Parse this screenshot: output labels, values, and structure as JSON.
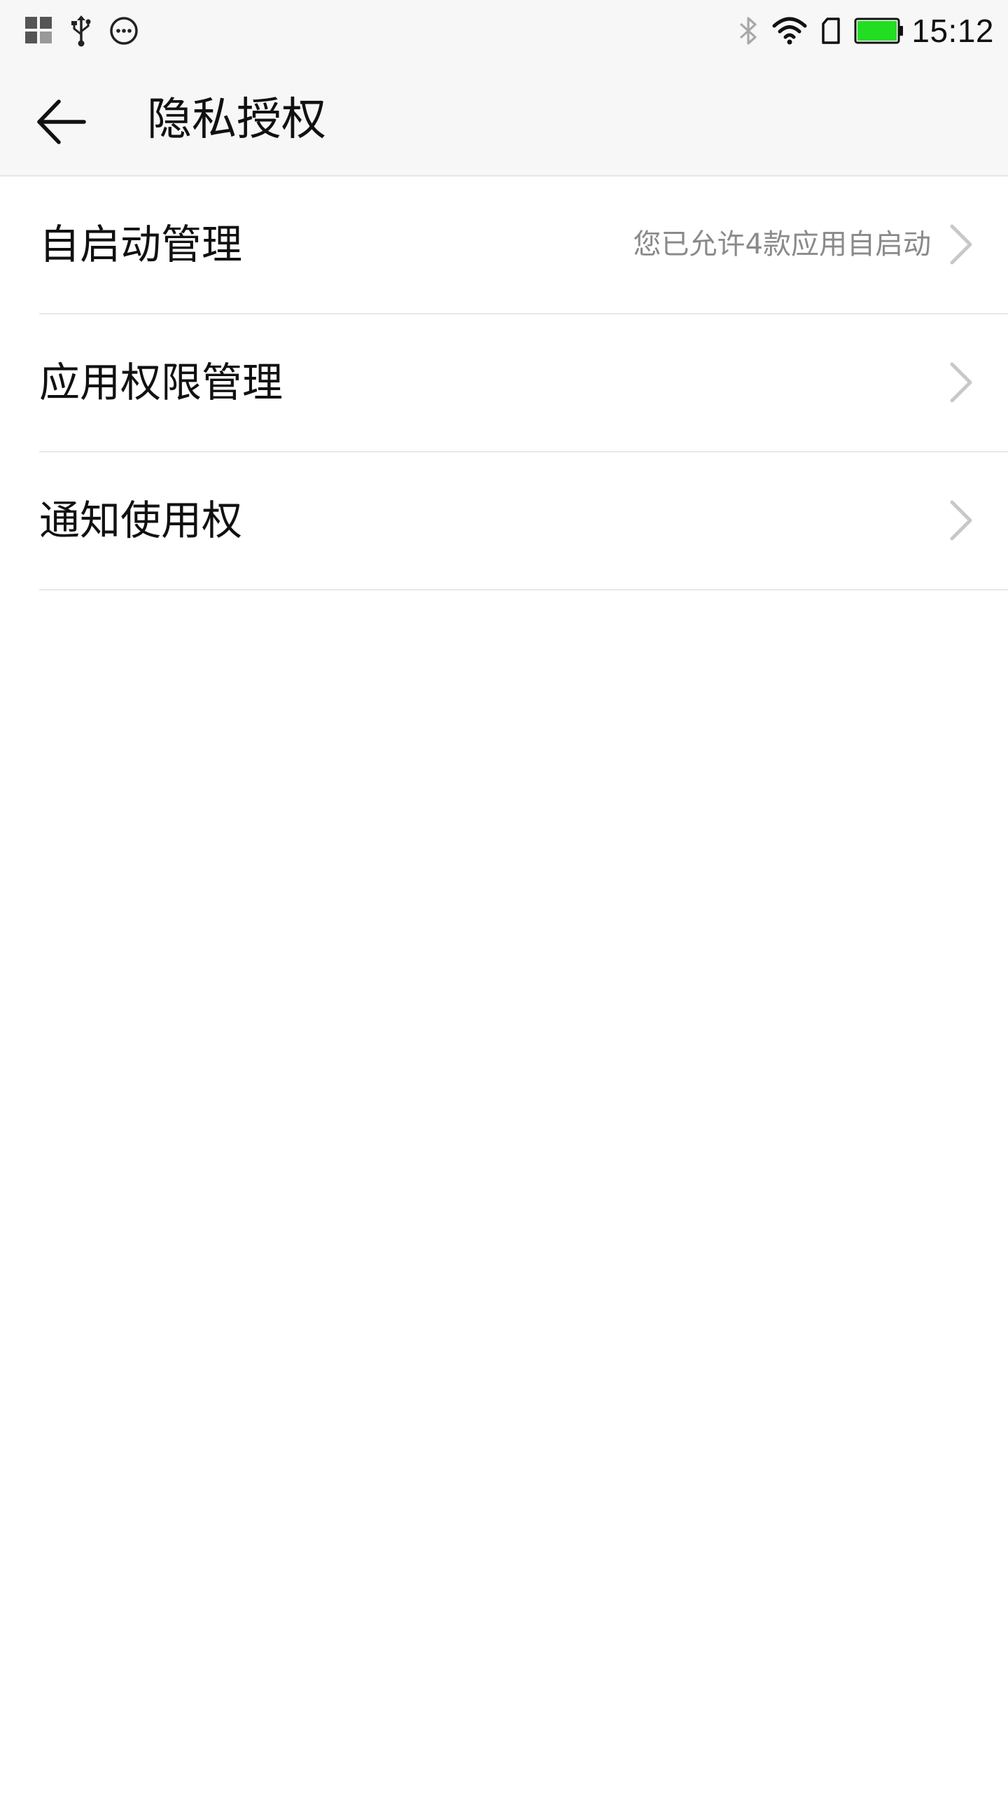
{
  "status_bar": {
    "left_icons": [
      "app-grid-icon",
      "usb-icon",
      "more-circle-icon"
    ],
    "right_icons": [
      "bluetooth-icon",
      "wifi-icon",
      "sim-card-icon",
      "battery-icon"
    ],
    "battery_color": "#22dd22",
    "battery_level": 1.0,
    "time": "15:12"
  },
  "header": {
    "back_icon": "arrow-left-icon",
    "title": "隐私授权"
  },
  "menu": {
    "items": [
      {
        "label": "自启动管理",
        "detail": "您已允许4款应用自启动"
      },
      {
        "label": "应用权限管理",
        "detail": ""
      },
      {
        "label": "通知使用权",
        "detail": ""
      }
    ],
    "chevron_icon": "chevron-right-icon"
  },
  "colors": {
    "bar_background": "#f7f7f7",
    "page_background": "#ffffff",
    "primary_text": "#111111",
    "secondary_text": "#8a8a8a",
    "divider": "#e8e8e8",
    "chevron": "#c8c8c8"
  }
}
